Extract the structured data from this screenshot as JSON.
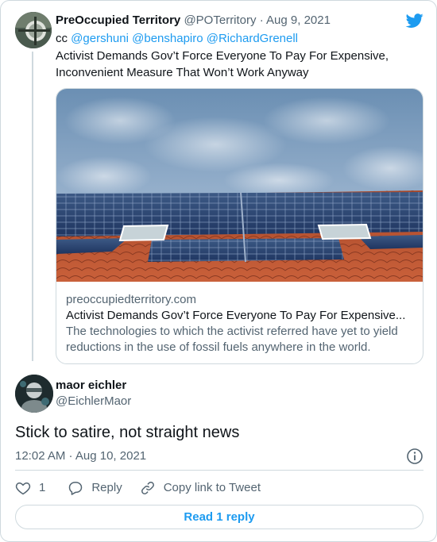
{
  "quoted_tweet": {
    "author_name": "PreOccupied Territory",
    "author_handle": "@POTerritory",
    "separator": "·",
    "date": "Aug 9, 2021",
    "cc_label": "cc",
    "mentions": [
      "@gershuni",
      "@benshapiro",
      "@RichardGrenell"
    ],
    "text": "Activist Demands Gov’t Force Everyone To Pay For Expensive, Inconvenient Measure That Won’t Work Anyway",
    "link_card": {
      "image_icon": "solar-panels-roof-photo",
      "domain": "preoccupiedterritory.com",
      "title": "Activist Demands Gov’t Force Everyone To Pay For Expensive...",
      "description": "The technologies to which the activist referred have yet to yield reductions in the use of fossil fuels anywhere in the world."
    }
  },
  "tweet": {
    "author_name": "maor eichler",
    "author_handle": "@EichlerMaor",
    "text": "Stick to satire, not straight news",
    "timestamp": "12:02 AM · Aug 10, 2021"
  },
  "actions": {
    "like_count": "1",
    "reply_label": "Reply",
    "copy_link_label": "Copy link to Tweet"
  },
  "read_replies_label": "Read 1 reply",
  "icons": {
    "brand": "twitter-bird-icon",
    "info": "info-icon",
    "like": "heart-icon",
    "reply": "reply-bubble-icon",
    "copy": "link-icon"
  },
  "colors": {
    "accent": "#1d9bf0",
    "text_primary": "#0f1419",
    "text_secondary": "#536471",
    "border": "#cfd9de"
  }
}
